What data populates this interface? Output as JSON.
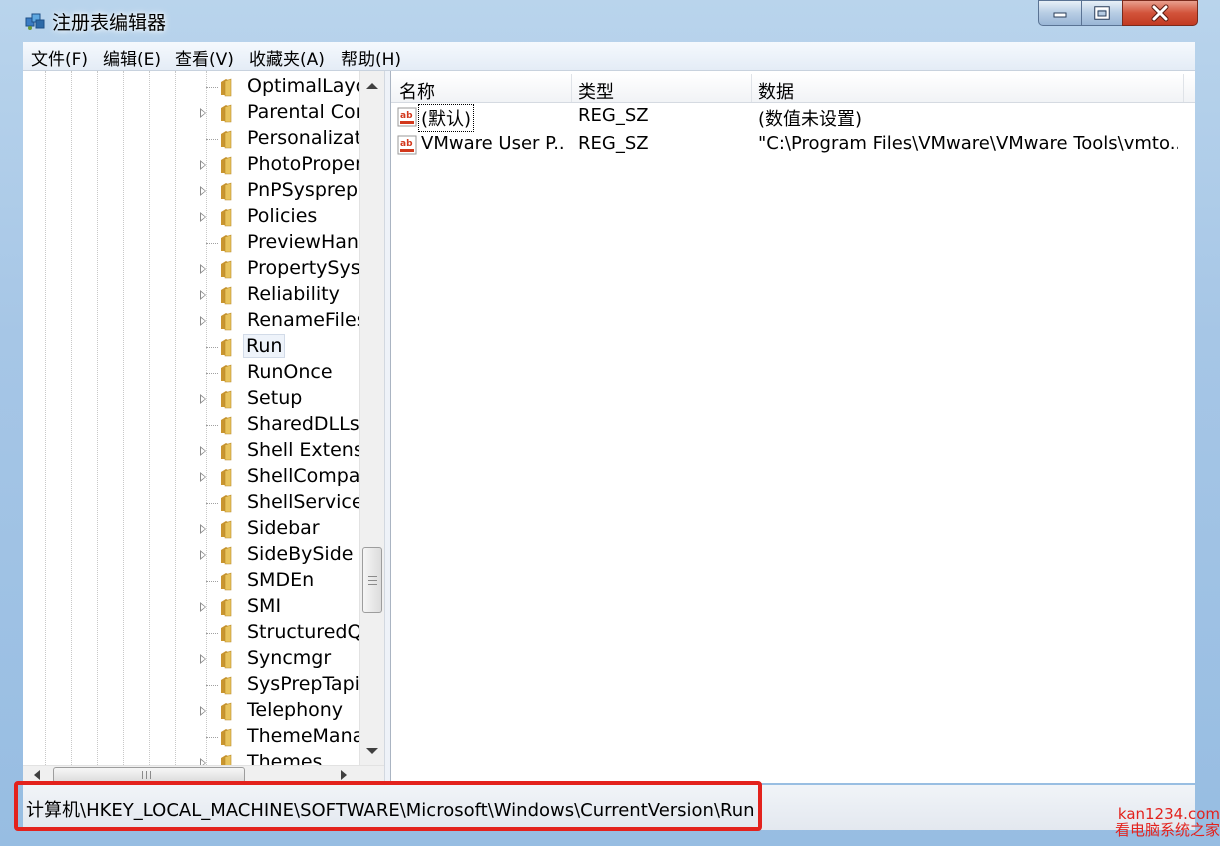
{
  "window": {
    "title": "注册表编辑器",
    "app_icon": "registry-editor-icon"
  },
  "title_buttons": {
    "minimize_icon": "minimize-icon",
    "maximize_icon": "maximize-icon",
    "close_icon": "close-icon"
  },
  "menubar": {
    "items": [
      "文件(F)",
      "编辑(E)",
      "查看(V)",
      "收藏夹(A)",
      "帮助(H)"
    ]
  },
  "tree": {
    "items": [
      {
        "label": "OptimalLayo",
        "expandable": false
      },
      {
        "label": "Parental Con",
        "expandable": true
      },
      {
        "label": "Personalizati",
        "expandable": false
      },
      {
        "label": "PhotoProper",
        "expandable": true
      },
      {
        "label": "PnPSysprep",
        "expandable": true
      },
      {
        "label": "Policies",
        "expandable": true
      },
      {
        "label": "PreviewHand",
        "expandable": false
      },
      {
        "label": "PropertySyst",
        "expandable": true
      },
      {
        "label": "Reliability",
        "expandable": true
      },
      {
        "label": "RenameFiles",
        "expandable": true
      },
      {
        "label": "Run",
        "expandable": false,
        "selected": true
      },
      {
        "label": "RunOnce",
        "expandable": false
      },
      {
        "label": "Setup",
        "expandable": true
      },
      {
        "label": "SharedDLLs",
        "expandable": false
      },
      {
        "label": "Shell Extensio",
        "expandable": true
      },
      {
        "label": "ShellCompat",
        "expandable": true
      },
      {
        "label": "ShellServiceC",
        "expandable": false
      },
      {
        "label": "Sidebar",
        "expandable": true
      },
      {
        "label": "SideBySide",
        "expandable": true
      },
      {
        "label": "SMDEn",
        "expandable": false
      },
      {
        "label": "SMI",
        "expandable": true
      },
      {
        "label": "StructuredQu",
        "expandable": false
      },
      {
        "label": "Syncmgr",
        "expandable": true
      },
      {
        "label": "SysPrepTapi",
        "expandable": false
      },
      {
        "label": "Telephony",
        "expandable": true
      },
      {
        "label": "ThemeManag",
        "expandable": false
      },
      {
        "label": "Themes",
        "expandable": true
      }
    ]
  },
  "list": {
    "columns": [
      "名称",
      "类型",
      "数据"
    ],
    "rows": [
      {
        "name": "(默认)",
        "type": "REG_SZ",
        "data": "(数值未设置)",
        "icon": "string-value-icon"
      },
      {
        "name": "VMware User P...",
        "type": "REG_SZ",
        "data": "\"C:\\Program Files\\VMware\\VMware Tools\\vmto...",
        "icon": "string-value-icon"
      }
    ]
  },
  "statusbar": {
    "path": "计算机\\HKEY_LOCAL_MACHINE\\SOFTWARE\\Microsoft\\Windows\\CurrentVersion\\Run"
  },
  "watermark": {
    "line1": "kan1234.com",
    "line2": "看电脑系统之家"
  },
  "colors": {
    "highlight_box": "#e3221d",
    "folder": "#e8c35c"
  }
}
